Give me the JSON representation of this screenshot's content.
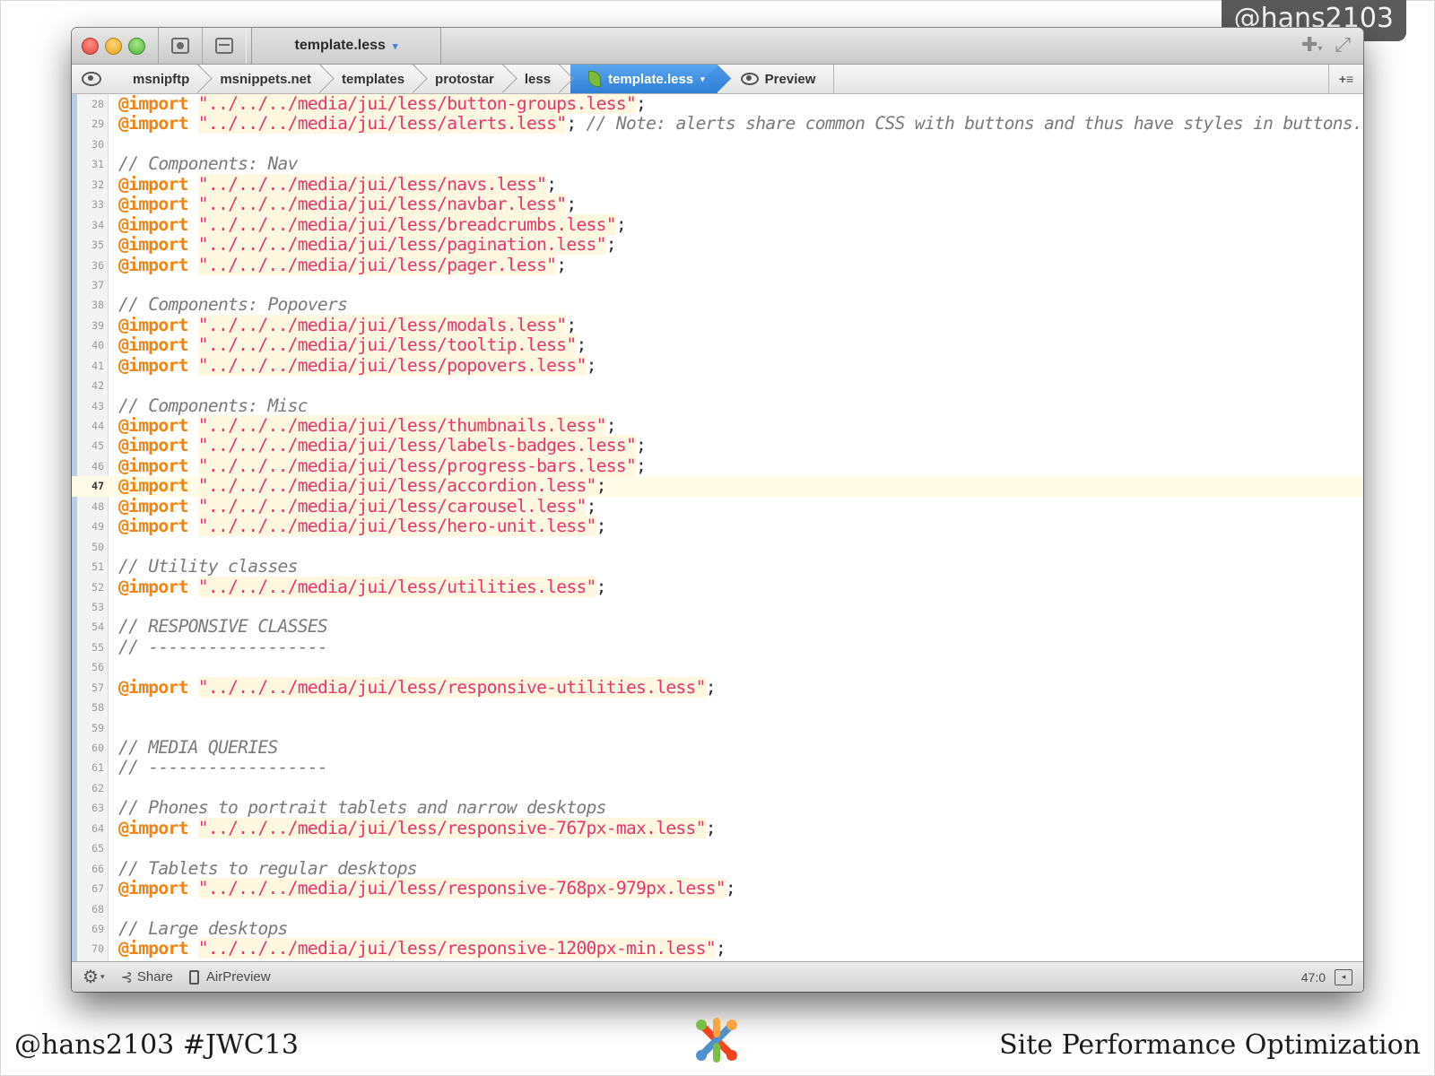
{
  "slide": {
    "handle_badge": "@hans2103",
    "footer_left": "@hans2103 #JWC13",
    "footer_right": "Site Performance Optimization"
  },
  "window": {
    "tab_title": "template.less",
    "breadcrumbs": [
      "msnipftp",
      "msnippets.net",
      "templates",
      "protostar",
      "less"
    ],
    "current_file": "template.less",
    "preview_label": "Preview"
  },
  "editor": {
    "current_line": 47,
    "lines": [
      {
        "n": "28",
        "t": [
          [
            "kw",
            "@import"
          ],
          [
            "pun",
            " "
          ],
          [
            "str",
            "\"../../../media/jui/less/button-groups.less\""
          ],
          [
            "pun",
            ";"
          ]
        ]
      },
      {
        "n": "29",
        "t": [
          [
            "kw",
            "@import"
          ],
          [
            "pun",
            " "
          ],
          [
            "str",
            "\"../../../media/jui/less/alerts.less\""
          ],
          [
            "pun",
            "; "
          ],
          [
            "cmt",
            "// Note: alerts share common CSS with buttons and thus have styles in buttons.less"
          ]
        ]
      },
      {
        "n": "30",
        "t": []
      },
      {
        "n": "31",
        "t": [
          [
            "cmt",
            "// Components: Nav"
          ]
        ]
      },
      {
        "n": "32",
        "t": [
          [
            "kw",
            "@import"
          ],
          [
            "pun",
            " "
          ],
          [
            "str",
            "\"../../../media/jui/less/navs.less\""
          ],
          [
            "pun",
            ";"
          ]
        ]
      },
      {
        "n": "33",
        "t": [
          [
            "kw",
            "@import"
          ],
          [
            "pun",
            " "
          ],
          [
            "str",
            "\"../../../media/jui/less/navbar.less\""
          ],
          [
            "pun",
            ";"
          ]
        ]
      },
      {
        "n": "34",
        "t": [
          [
            "kw",
            "@import"
          ],
          [
            "pun",
            " "
          ],
          [
            "str",
            "\"../../../media/jui/less/breadcrumbs.less\""
          ],
          [
            "pun",
            ";"
          ]
        ]
      },
      {
        "n": "35",
        "t": [
          [
            "kw",
            "@import"
          ],
          [
            "pun",
            " "
          ],
          [
            "str",
            "\"../../../media/jui/less/pagination.less\""
          ],
          [
            "pun",
            ";"
          ]
        ]
      },
      {
        "n": "36",
        "t": [
          [
            "kw",
            "@import"
          ],
          [
            "pun",
            " "
          ],
          [
            "str",
            "\"../../../media/jui/less/pager.less\""
          ],
          [
            "pun",
            ";"
          ]
        ]
      },
      {
        "n": "37",
        "t": []
      },
      {
        "n": "38",
        "t": [
          [
            "cmt",
            "// Components: Popovers"
          ]
        ]
      },
      {
        "n": "39",
        "t": [
          [
            "kw",
            "@import"
          ],
          [
            "pun",
            " "
          ],
          [
            "str",
            "\"../../../media/jui/less/modals.less\""
          ],
          [
            "pun",
            ";"
          ]
        ]
      },
      {
        "n": "40",
        "t": [
          [
            "kw",
            "@import"
          ],
          [
            "pun",
            " "
          ],
          [
            "str",
            "\"../../../media/jui/less/tooltip.less\""
          ],
          [
            "pun",
            ";"
          ]
        ]
      },
      {
        "n": "41",
        "t": [
          [
            "kw",
            "@import"
          ],
          [
            "pun",
            " "
          ],
          [
            "str",
            "\"../../../media/jui/less/popovers.less\""
          ],
          [
            "pun",
            ";"
          ]
        ]
      },
      {
        "n": "42",
        "t": []
      },
      {
        "n": "43",
        "t": [
          [
            "cmt",
            "// Components: Misc"
          ]
        ]
      },
      {
        "n": "44",
        "t": [
          [
            "kw",
            "@import"
          ],
          [
            "pun",
            " "
          ],
          [
            "str",
            "\"../../../media/jui/less/thumbnails.less\""
          ],
          [
            "pun",
            ";"
          ]
        ]
      },
      {
        "n": "45",
        "t": [
          [
            "kw",
            "@import"
          ],
          [
            "pun",
            " "
          ],
          [
            "str",
            "\"../../../media/jui/less/labels-badges.less\""
          ],
          [
            "pun",
            ";"
          ]
        ]
      },
      {
        "n": "46",
        "t": [
          [
            "kw",
            "@import"
          ],
          [
            "pun",
            " "
          ],
          [
            "str",
            "\"../../../media/jui/less/progress-bars.less\""
          ],
          [
            "pun",
            ";"
          ]
        ]
      },
      {
        "n": "47",
        "t": [
          [
            "kw",
            "@import"
          ],
          [
            "pun",
            " "
          ],
          [
            "str",
            "\"../../../media/jui/less/accordion.less\""
          ],
          [
            "pun",
            ";"
          ]
        ]
      },
      {
        "n": "48",
        "t": [
          [
            "kw",
            "@import"
          ],
          [
            "pun",
            " "
          ],
          [
            "str",
            "\"../../../media/jui/less/carousel.less\""
          ],
          [
            "pun",
            ";"
          ]
        ]
      },
      {
        "n": "49",
        "t": [
          [
            "kw",
            "@import"
          ],
          [
            "pun",
            " "
          ],
          [
            "str",
            "\"../../../media/jui/less/hero-unit.less\""
          ],
          [
            "pun",
            ";"
          ]
        ]
      },
      {
        "n": "50",
        "t": []
      },
      {
        "n": "51",
        "t": [
          [
            "cmt",
            "// Utility classes"
          ]
        ]
      },
      {
        "n": "52",
        "t": [
          [
            "kw",
            "@import"
          ],
          [
            "pun",
            " "
          ],
          [
            "str",
            "\"../../../media/jui/less/utilities.less\""
          ],
          [
            "pun",
            ";"
          ]
        ]
      },
      {
        "n": "53",
        "t": []
      },
      {
        "n": "54",
        "t": [
          [
            "cmt",
            "// RESPONSIVE CLASSES"
          ]
        ]
      },
      {
        "n": "55",
        "t": [
          [
            "cmt",
            "// ------------------"
          ]
        ]
      },
      {
        "n": "56",
        "t": []
      },
      {
        "n": "57",
        "t": [
          [
            "kw",
            "@import"
          ],
          [
            "pun",
            " "
          ],
          [
            "str",
            "\"../../../media/jui/less/responsive-utilities.less\""
          ],
          [
            "pun",
            ";"
          ]
        ]
      },
      {
        "n": "58",
        "t": []
      },
      {
        "n": "59",
        "t": []
      },
      {
        "n": "60",
        "t": [
          [
            "cmt",
            "// MEDIA QUERIES"
          ]
        ]
      },
      {
        "n": "61",
        "t": [
          [
            "cmt",
            "// ------------------"
          ]
        ]
      },
      {
        "n": "62",
        "t": []
      },
      {
        "n": "63",
        "t": [
          [
            "cmt",
            "// Phones to portrait tablets and narrow desktops"
          ]
        ]
      },
      {
        "n": "64",
        "t": [
          [
            "kw",
            "@import"
          ],
          [
            "pun",
            " "
          ],
          [
            "str",
            "\"../../../media/jui/less/responsive-767px-max.less\""
          ],
          [
            "pun",
            ";"
          ]
        ]
      },
      {
        "n": "65",
        "t": []
      },
      {
        "n": "66",
        "t": [
          [
            "cmt",
            "// Tablets to regular desktops"
          ]
        ]
      },
      {
        "n": "67",
        "t": [
          [
            "kw",
            "@import"
          ],
          [
            "pun",
            " "
          ],
          [
            "str",
            "\"../../../media/jui/less/responsive-768px-979px.less\""
          ],
          [
            "pun",
            ";"
          ]
        ]
      },
      {
        "n": "68",
        "t": []
      },
      {
        "n": "69",
        "t": [
          [
            "cmt",
            "// Large desktops"
          ]
        ]
      },
      {
        "n": "70",
        "t": [
          [
            "kw",
            "@import"
          ],
          [
            "pun",
            " "
          ],
          [
            "str",
            "\"../../../media/jui/less/responsive-1200px-min.less\""
          ],
          [
            "pun",
            ";"
          ]
        ]
      }
    ]
  },
  "statusbar": {
    "share_label": "Share",
    "airpreview_label": "AirPreview",
    "cursor_position": "47:0"
  },
  "colors": {
    "keyword": "#ee8514",
    "string": "#e8366b",
    "comment": "#7a7a7a",
    "breadcrumb_active": "#2f7fd6"
  },
  "icons": {
    "gear": "gear-icon",
    "share": "share-icon",
    "airpreview": "device-icon",
    "preview": "eye-icon"
  }
}
